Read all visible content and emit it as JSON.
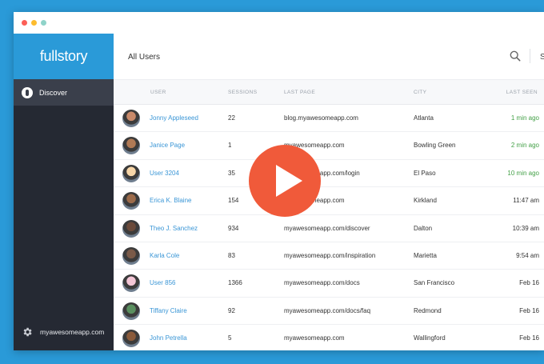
{
  "colors": {
    "brand": "#2a9ad8",
    "sidebar": "#252933",
    "play": "#f05a3a",
    "link": "#3a96d6",
    "recent": "#43a047"
  },
  "sidebar": {
    "logo": "fullstory",
    "nav": [
      {
        "label": "Discover",
        "icon": "compass-icon",
        "active": true
      }
    ],
    "site": {
      "label": "myawesomeapp.com",
      "icon": "gear-icon"
    }
  },
  "header": {
    "title": "All Users",
    "search_icon": "search-icon",
    "truncated_label": "S"
  },
  "table": {
    "columns": [
      "USER",
      "SESSIONS",
      "LAST PAGE",
      "CITY",
      "LAST SEEN"
    ],
    "rows": [
      {
        "user": "Jonny Appleseed",
        "sessions": "22",
        "last_page": "blog.myawesomeapp.com",
        "city": "Atlanta",
        "last_seen": "1 min ago",
        "recent": true
      },
      {
        "user": "Janice Page",
        "sessions": "1",
        "last_page": "myawesomeapp.com",
        "city": "Bowling Green",
        "last_seen": "2 min ago",
        "recent": true
      },
      {
        "user": "User 3204",
        "sessions": "35",
        "last_page": "myawesomeapp.com/login",
        "city": "El Paso",
        "last_seen": "10 min ago",
        "recent": true
      },
      {
        "user": "Erica K. Blaine",
        "sessions": "154",
        "last_page": "myawesomeapp.com",
        "city": "Kirkland",
        "last_seen": "11:47 am",
        "recent": false
      },
      {
        "user": "Theo J. Sanchez",
        "sessions": "934",
        "last_page": "myawesomeapp.com/discover",
        "city": "Dalton",
        "last_seen": "10:39 am",
        "recent": false
      },
      {
        "user": "Karla Cole",
        "sessions": "83",
        "last_page": "myawesomeapp.com/inspiration",
        "city": "Marietta",
        "last_seen": "9:54 am",
        "recent": false
      },
      {
        "user": "User 856",
        "sessions": "1366",
        "last_page": "myawesomeapp.com/docs",
        "city": "San Francisco",
        "last_seen": "Feb 16",
        "recent": false
      },
      {
        "user": "Tiffany Claire",
        "sessions": "92",
        "last_page": "myawesomeapp.com/docs/faq",
        "city": "Redmond",
        "last_seen": "Feb 16",
        "recent": false
      },
      {
        "user": "John Petrella",
        "sessions": "5",
        "last_page": "myawesomeapp.com",
        "city": "Wallingford",
        "last_seen": "Feb 16",
        "recent": false
      }
    ]
  },
  "overlay": {
    "icon": "play-icon"
  }
}
